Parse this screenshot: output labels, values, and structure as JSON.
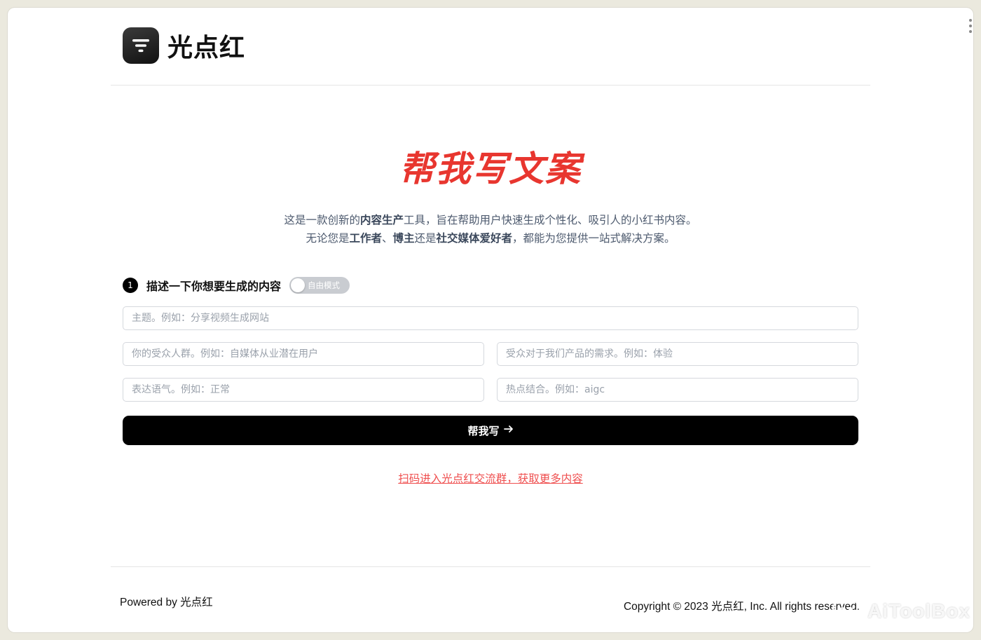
{
  "header": {
    "brand": "光点红",
    "logo_icon": "filter-list-icon"
  },
  "hero": {
    "title": "帮我写文案",
    "title_color": "#e8362f",
    "desc_line1": [
      {
        "text": "这是一款创新的",
        "bold": false
      },
      {
        "text": "内容生产",
        "bold": true
      },
      {
        "text": "工具，旨在帮助用户快速生成个性化、吸引人的小红书内容。",
        "bold": false
      }
    ],
    "desc_line2": [
      {
        "text": "无论您是",
        "bold": false
      },
      {
        "text": "工作者",
        "bold": true
      },
      {
        "text": "、",
        "bold": false
      },
      {
        "text": "博主",
        "bold": true
      },
      {
        "text": "还是",
        "bold": false
      },
      {
        "text": "社交媒体爱好者",
        "bold": true
      },
      {
        "text": "，都能为您提供一站式解决方案。",
        "bold": false
      }
    ]
  },
  "step": {
    "number": "1",
    "label": "描述一下你想要生成的内容",
    "toggle_label": "自由模式"
  },
  "form": {
    "topic_placeholder": "主题。例如：分享视频生成网站",
    "audience_placeholder": "你的受众人群。例如：自媒体从业潜在用户",
    "need_placeholder": "受众对于我们产品的需求。例如：体验",
    "tone_placeholder": "表达语气。例如：正常",
    "hotspot_placeholder": "热点结合。例如：aigc",
    "submit_label": "帮我写",
    "submit_icon": "arrow-right-icon"
  },
  "link": {
    "community_text": "扫码进入光点红交流群，获取更多内容",
    "color": "#ef4f4f"
  },
  "footer": {
    "powered": "Powered by 光点红",
    "copyright": "Copyright © 2023 光点红, Inc. All rights reserved."
  },
  "watermark": {
    "text": "AiToolBox",
    "icon": "robot-face-icon"
  }
}
